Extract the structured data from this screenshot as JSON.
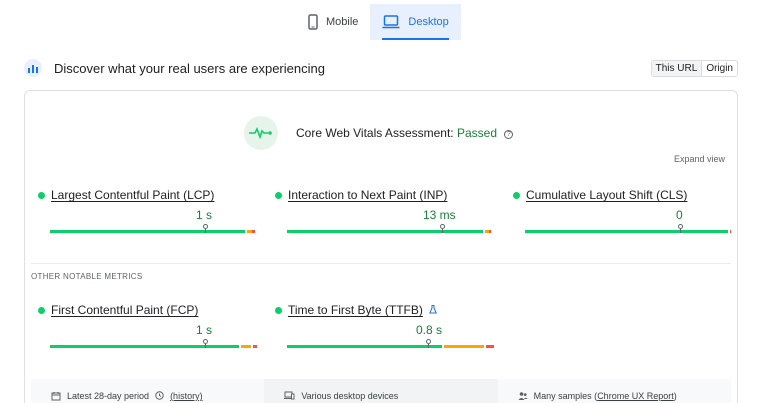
{
  "tabs": [
    {
      "label": "Mobile",
      "icon": "smartphone-icon",
      "active": false
    },
    {
      "label": "Desktop",
      "icon": "laptop-icon",
      "active": true
    }
  ],
  "discover": {
    "title": "Discover what your real users are experiencing",
    "toggle": [
      "This URL",
      "Origin"
    ]
  },
  "assessment": {
    "prefix": "Core Web Vitals Assessment:",
    "status": "Passed",
    "help": "?",
    "expand": "Expand view"
  },
  "metrics": [
    {
      "name": "Largest Contentful Paint (LCP)",
      "value": "1 s",
      "percentile_position": 0.75
    },
    {
      "name": "Interaction to Next Paint (INP)",
      "value": "13 ms",
      "percentile_position": 0.75
    },
    {
      "name": "Cumulative Layout Shift (CLS)",
      "value": "0",
      "percentile_position": 0.75
    }
  ],
  "other_section_label": "OTHER NOTABLE METRICS",
  "other_metrics": [
    {
      "name": "First Contentful Paint (FCP)",
      "value": "1 s",
      "percentile_position": 0.75
    },
    {
      "name": "Time to First Byte (TTFB)",
      "value": "0.8 s",
      "percentile_position": 0.75,
      "experimental_icon": "flask-icon"
    }
  ],
  "footer": {
    "period": "Latest 28-day period",
    "history_link": "(history)",
    "devices": "Various desktop devices",
    "samples_prefix": "Many samples (",
    "samples_link": "Chrome UX Report",
    "samples_suffix": ")"
  },
  "colors": {
    "good": "#0cce6b",
    "average": "#ffa400",
    "poor": "#ff4e42",
    "accent": "#1a73e8",
    "passed_text": "#188038"
  }
}
